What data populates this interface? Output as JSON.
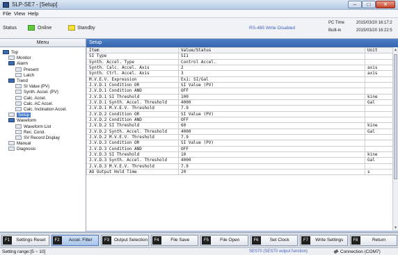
{
  "window": {
    "title": "SLP-SE7 - [Setup]"
  },
  "menubar": {
    "items": [
      "File",
      "View",
      "Help"
    ]
  },
  "status": {
    "label": "Status",
    "online": "Online",
    "standby": "Standby",
    "rs485": "RS-485 Write Disabled",
    "pc_time_label": "PC Time",
    "pc_time_value": "2015/03/20 16:17:2",
    "built_in_label": "Built-in",
    "built_in_value": "2015/03/20 16:22:5"
  },
  "menu_panel": {
    "header": "Menu"
  },
  "setup_panel": {
    "header": "Setup"
  },
  "tree": [
    {
      "label": "Top",
      "level": 0,
      "icon": "folder-icon"
    },
    {
      "label": "Monitor",
      "level": 1,
      "icon": "page-icon"
    },
    {
      "label": "Alarm",
      "level": 1,
      "icon": "folder-icon"
    },
    {
      "label": "Present",
      "level": 2,
      "icon": "page-icon"
    },
    {
      "label": "Latch",
      "level": 2,
      "icon": "page-icon"
    },
    {
      "label": "Trend",
      "level": 1,
      "icon": "folder-icon"
    },
    {
      "label": "SI Value (PV)",
      "level": 2,
      "icon": "page-icon"
    },
    {
      "label": "Synth. Accel. (PV)",
      "level": 2,
      "icon": "page-icon"
    },
    {
      "label": "Calc. Accel.",
      "level": 2,
      "icon": "page-icon"
    },
    {
      "label": "Calc. AC Accel.",
      "level": 2,
      "icon": "page-icon"
    },
    {
      "label": "Calc. Inclination Accel.",
      "level": 2,
      "icon": "page-icon"
    },
    {
      "label": "Setup",
      "level": 1,
      "icon": "page-icon",
      "selected": true
    },
    {
      "label": "Waveform",
      "level": 1,
      "icon": "folder-icon"
    },
    {
      "label": "Waveform List",
      "level": 2,
      "icon": "page-icon"
    },
    {
      "label": "Rec. Cond.",
      "level": 2,
      "icon": "page-icon"
    },
    {
      "label": "SV Record Display",
      "level": 2,
      "icon": "page-icon"
    },
    {
      "label": "Manual",
      "level": 1,
      "icon": "page-icon"
    },
    {
      "label": "Diagnosis",
      "level": 1,
      "icon": "page-icon"
    }
  ],
  "table": {
    "headers": [
      "Item",
      "Value/Status",
      "Unit"
    ],
    "rows": [
      [
        "SI Type",
        "SI1",
        ""
      ],
      [
        "Synth. Accel. Type",
        "Control Accel.",
        ""
      ],
      [
        "Synth. Calc. Accel. Axis",
        "2",
        "axis"
      ],
      [
        "Synth. Ctrl. Accel. Axis",
        "3",
        "axis"
      ],
      [
        "M.V.E.V. Expression",
        "Ex1: SI/Gal",
        ""
      ],
      [
        "J.V.D.1 Condition OR",
        "SI Value (PV)",
        ""
      ],
      [
        "J.V.D.1 Condition AND",
        "OFF",
        ""
      ],
      [
        "J.V.D.1 SI Threshold",
        "100",
        "kine"
      ],
      [
        "J.V.D.1 Synth. Accel. Threshold",
        "4000",
        "Gal"
      ],
      [
        "J.V.D.1 M.V.E.V. Threshold",
        "7.9",
        ""
      ],
      [
        "J.V.D.2 Condition OR",
        "SI Value (PV)",
        ""
      ],
      [
        "J.V.D.2 Condition AND",
        "OFF",
        ""
      ],
      [
        "J.V.D.2 SI Threshold",
        "60",
        "kine"
      ],
      [
        "J.V.D.2 Synth. Accel. Threshold",
        "4000",
        "Gal"
      ],
      [
        "J.V.D.2 M.V.E.V. Threshold",
        "7.9",
        ""
      ],
      [
        "J.V.D.3 Condition OR",
        "SI Value (PV)",
        ""
      ],
      [
        "J.V.D.3 Condition AND",
        "OFF",
        ""
      ],
      [
        "J.V.D.3 SI Threshold",
        "10",
        "kine"
      ],
      [
        "J.V.D.3 Synth. Accel. Threshold",
        "4000",
        "Gal"
      ],
      [
        "J.V.D.3 M.V.E.V. Threshold",
        "7.9",
        ""
      ],
      [
        "AO Output Hold Time",
        "20",
        "s"
      ]
    ]
  },
  "fkeys": [
    {
      "num": "F1",
      "label": "Settings Reset"
    },
    {
      "num": "F2",
      "label": "Accel. Filter",
      "active": true
    },
    {
      "num": "F3",
      "label": "Output Selection"
    },
    {
      "num": "F4",
      "label": "File Save"
    },
    {
      "num": "F5",
      "label": "File Open"
    },
    {
      "num": "F6",
      "label": "Set Clock"
    },
    {
      "num": "F7",
      "label": "Write Settings"
    },
    {
      "num": "F8",
      "label": "Return"
    }
  ],
  "bottom": {
    "range": "Setting range:[5 ~ 10]",
    "ses": "SES70 (SES70 output function)",
    "connection": "Connection (COM7)"
  },
  "colors": {
    "online": "#5fcd3c",
    "standby": "#f2e23a",
    "accent": "#3f76c8"
  }
}
